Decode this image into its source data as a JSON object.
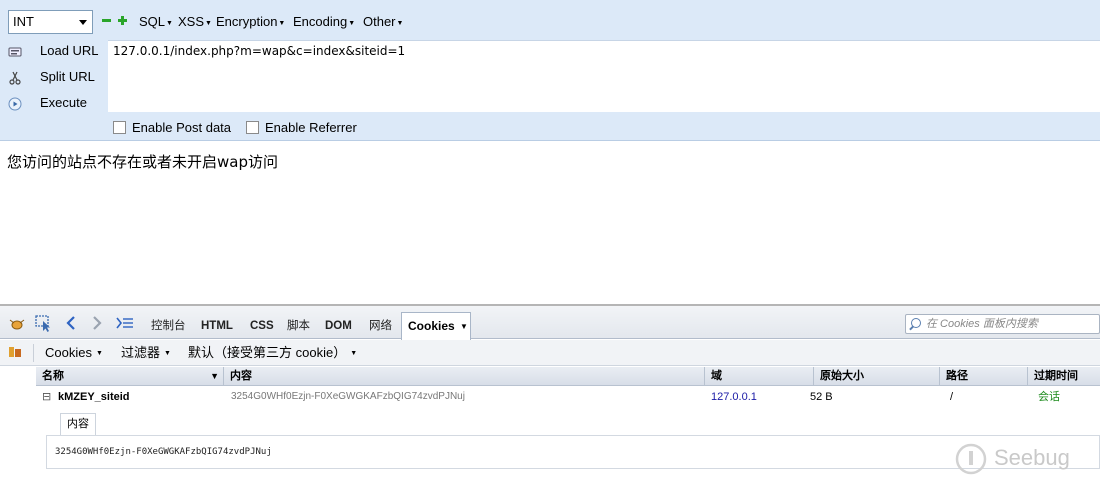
{
  "hackbar": {
    "select_value": "INT",
    "menus": [
      "SQL",
      "XSS",
      "Encryption",
      "Encoding",
      "Other"
    ],
    "buttons": {
      "load_url": "Load URL",
      "split_url": "Split URL",
      "execute": "Execute"
    },
    "url_value": "127.0.0.1/index.php?m=wap&c=index&siteid=1",
    "checkboxes": {
      "post": "Enable Post data",
      "referrer": "Enable Referrer"
    }
  },
  "page": {
    "message": "您访问的站点不存在或者未开启wap访问"
  },
  "devtools": {
    "tabs": [
      "控制台",
      "HTML",
      "CSS",
      "脚本",
      "DOM",
      "网络"
    ],
    "active_tab": "Cookies",
    "search_placeholder": "在 Cookies 面板内搜索",
    "subtoolbar": {
      "cookies": "Cookies",
      "filter": "过滤器",
      "default": "默认（接受第三方 cookie）"
    },
    "columns": {
      "name": "名称",
      "content": "内容",
      "domain": "域",
      "raw_size": "原始大小",
      "path": "路径",
      "expires": "过期时间"
    },
    "row": {
      "toggle": "⊟",
      "name": "kMZEY_siteid",
      "content": "3254G0WHf0Ezjn-F0XeGWGKAFzbQIG74zvdPJNuj",
      "domain": "127.0.0.1",
      "raw_size": "52 B",
      "path": "/",
      "expires": "会话"
    },
    "detail": {
      "tab_label": "内容",
      "value": "3254G0WHf0Ezjn-F0XeGWGKAFzbQIG74zvdPJNuj"
    }
  },
  "watermark": {
    "text": "Seebug"
  },
  "colors": {
    "hackbar_bg": "#dce9f8",
    "accent_green": "#2aa52a",
    "domain_blue": "#1a1aa6",
    "session_green": "#1b8a1b"
  }
}
